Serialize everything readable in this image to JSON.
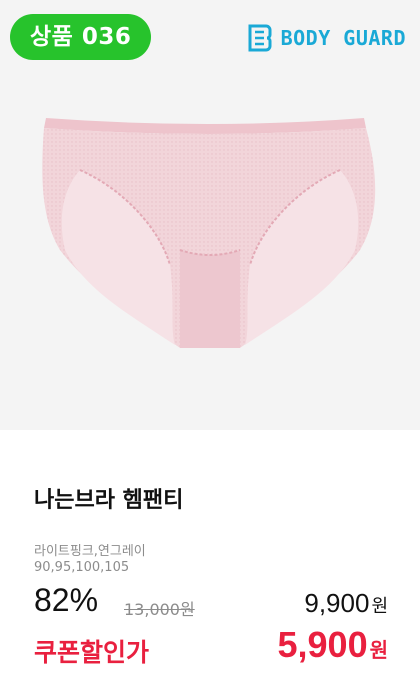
{
  "badge": {
    "label": "상품 036"
  },
  "brand": {
    "name": "BODY GUARD",
    "icon": "bodyguard-logo-icon",
    "color": "#1aa9d6"
  },
  "product": {
    "image_icon": "panty-image",
    "title": "나는브라 헴팬티",
    "colors": "라이트핑크,연그레이",
    "sizes": "90,95,100,105"
  },
  "price": {
    "discount_rate": "82%",
    "original": "13,000원",
    "sale": "9,900",
    "sale_unit": "원"
  },
  "coupon": {
    "label": "쿠폰할인가",
    "price": "5,900",
    "unit": "원",
    "color": "#e9203f"
  }
}
